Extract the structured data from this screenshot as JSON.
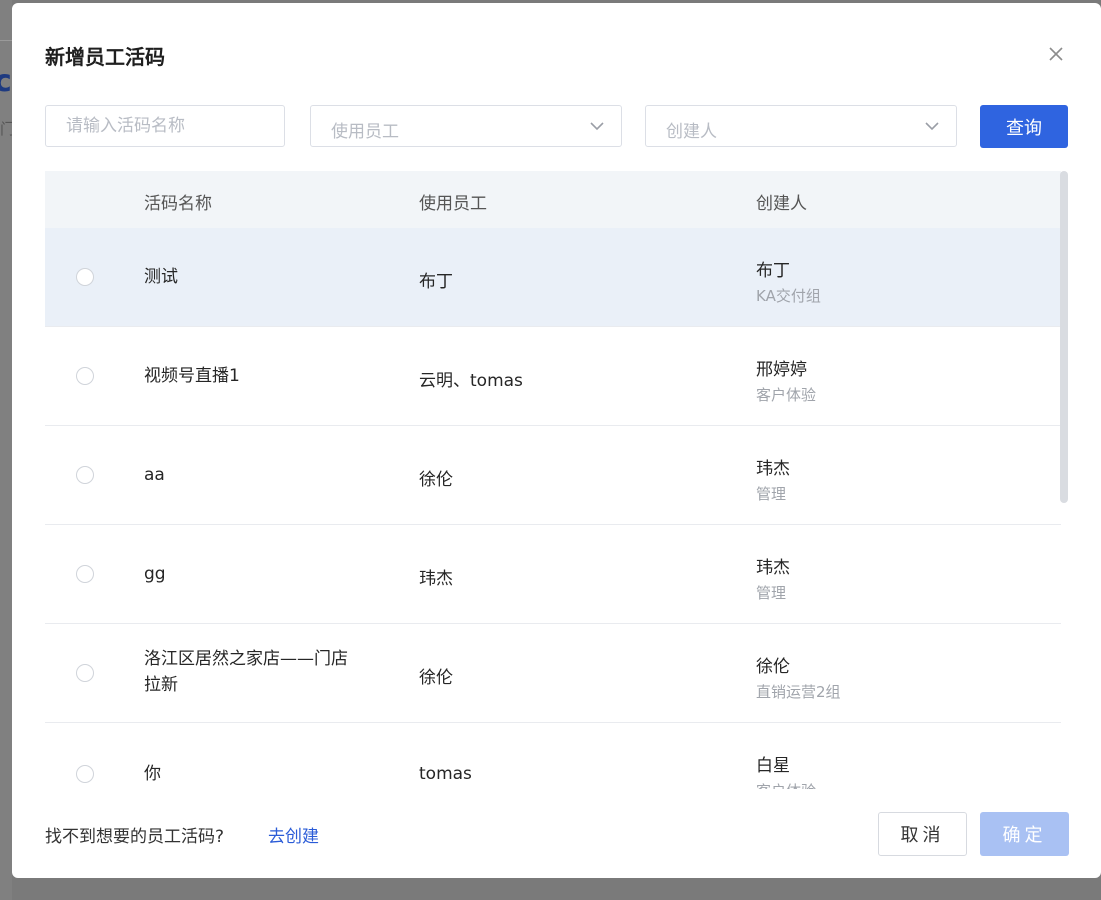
{
  "modal": {
    "title": "新增员工活码",
    "filters": {
      "name_placeholder": "请输入活码名称",
      "employee_placeholder": "使用员工",
      "creator_placeholder": "创建人",
      "query_label": "查询"
    },
    "table": {
      "headers": {
        "name": "活码名称",
        "employee": "使用员工",
        "creator": "创建人"
      },
      "rows": [
        {
          "name": "测试",
          "employee": "布丁",
          "creator": "布丁",
          "dept": "KA交付组",
          "selected": true
        },
        {
          "name": "视频号直播1",
          "employee": "云明、tomas",
          "creator": "邢婷婷",
          "dept": "客户体验",
          "selected": false
        },
        {
          "name": "aa",
          "employee": "徐伦",
          "creator": "玮杰",
          "dept": "管理",
          "selected": false
        },
        {
          "name": "gg",
          "employee": "玮杰",
          "creator": "玮杰",
          "dept": "管理",
          "selected": false
        },
        {
          "name": "洛江区居然之家店——门店拉新",
          "employee": "徐伦",
          "creator": "徐伦",
          "dept": "直销运营2组",
          "selected": false
        },
        {
          "name": "你",
          "employee": "tomas",
          "creator": "白星",
          "dept": "客户体验",
          "selected": false
        }
      ]
    },
    "footer": {
      "hint": "找不到想要的员工活码?",
      "create_link": "去创建",
      "cancel_label": "取消",
      "confirm_label": "确定"
    }
  },
  "background": {
    "glyph": "c",
    "small_glyph": "门"
  },
  "colors": {
    "primary": "#2f64e0",
    "primary_disabled": "#a9c1f3",
    "selected_row": "#eaf0f8",
    "header_bg": "#f2f5f8",
    "link": "#2a5bd7"
  },
  "icons": {
    "close": "close-icon",
    "dropdown": "chevron-down-icon"
  }
}
